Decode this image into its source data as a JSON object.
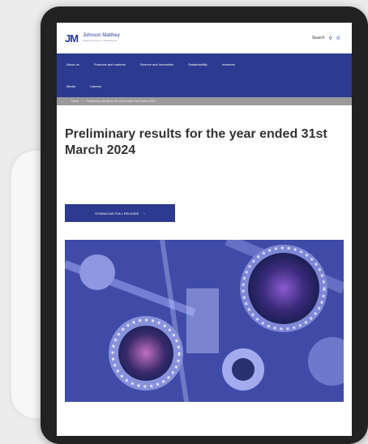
{
  "site": {
    "logo_mark": "JM",
    "logo_name": "Johnson Matthey",
    "logo_tagline": "Inspiring science, enhancing life",
    "search_label": "Search",
    "search_icon": "search-icon",
    "phone_icon": "phone-icon"
  },
  "nav": {
    "items_row1": [
      "About us",
      "Products and markets",
      "Science and innovation",
      "Sustainability",
      "Investors"
    ],
    "items_row2": [
      "Media",
      "Careers"
    ]
  },
  "breadcrumb": [
    "Home",
    "Preliminary results for the year ended 31st March 2024"
  ],
  "page": {
    "title": "Preliminary results for the year ended 31st March 2024",
    "download_label": "DOWNLOAD FULL RELEASE"
  },
  "colors": {
    "brand": "#2c3a8f",
    "breadcrumb": "#9a9a9a"
  }
}
